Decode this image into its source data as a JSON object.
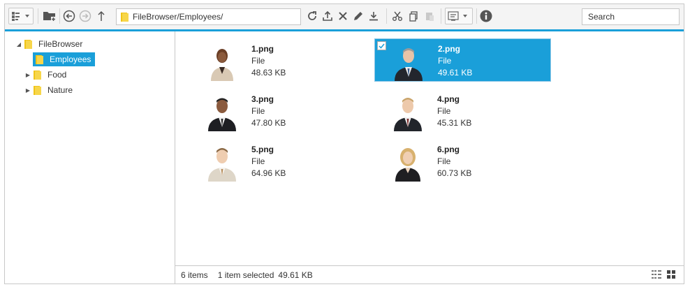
{
  "toolbar": {
    "address_path": "FileBrowser/Employees/",
    "search_placeholder": "Search"
  },
  "tree": {
    "root": "FileBrowser",
    "children": [
      {
        "label": "Employees",
        "selected": true
      },
      {
        "label": "Food",
        "selected": false
      },
      {
        "label": "Nature",
        "selected": false
      }
    ]
  },
  "files": [
    {
      "name": "1.png",
      "kind": "File",
      "size": "48.63 KB",
      "selected": false
    },
    {
      "name": "2.png",
      "kind": "File",
      "size": "49.61 KB",
      "selected": true
    },
    {
      "name": "3.png",
      "kind": "File",
      "size": "47.80 KB",
      "selected": false
    },
    {
      "name": "4.png",
      "kind": "File",
      "size": "45.31 KB",
      "selected": false
    },
    {
      "name": "5.png",
      "kind": "File",
      "size": "64.96 KB",
      "selected": false
    },
    {
      "name": "6.png",
      "kind": "File",
      "size": "60.73 KB",
      "selected": false
    }
  ],
  "status": {
    "item_count": "6 items",
    "selection": "1 item selected",
    "selected_size": "49.61 KB"
  },
  "colors": {
    "accent": "#1a9fd9",
    "folder": "#f0c419"
  }
}
